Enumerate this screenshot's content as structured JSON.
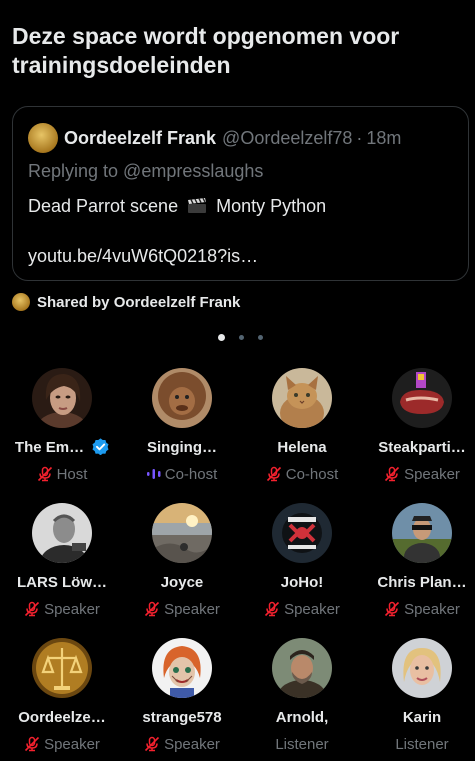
{
  "space": {
    "title": "Deze space wordt opgenomen voor trainingsdoeleinden"
  },
  "pinned_tweet": {
    "author_name": "Oordeelzelf Frank",
    "author_handle": "@Oordeelzelf78",
    "separator": "·",
    "time": "18m",
    "replying_to": "Replying to @empresslaughs",
    "text_before": "Dead Parrot scene",
    "text_after": "Monty Python",
    "emoji_icon": "clapper-board-icon",
    "link": "youtu.be/4vuW6tQ0218?is…"
  },
  "shared": {
    "label": "Shared by Oordeelzelf Frank"
  },
  "pager": {
    "total": 3,
    "active": 1
  },
  "participants": [
    {
      "name": "The Em…",
      "role": "Host",
      "verified": true,
      "mic": "muted"
    },
    {
      "name": "Singing…",
      "role": "Co-host",
      "verified": false,
      "mic": "speaking"
    },
    {
      "name": "Helena",
      "role": "Co-host",
      "verified": false,
      "mic": "muted"
    },
    {
      "name": "Steakparti…",
      "role": "Speaker",
      "verified": false,
      "mic": "muted"
    },
    {
      "name": "LARS Löw…",
      "role": "Speaker",
      "verified": false,
      "mic": "muted"
    },
    {
      "name": "Joyce",
      "role": "Speaker",
      "verified": false,
      "mic": "muted"
    },
    {
      "name": "JoHo!",
      "role": "Speaker",
      "verified": false,
      "mic": "muted"
    },
    {
      "name": "Chris Plan…",
      "role": "Speaker",
      "verified": false,
      "mic": "muted"
    },
    {
      "name": "Oordeelze…",
      "role": "Speaker",
      "verified": false,
      "mic": "muted"
    },
    {
      "name": "strange578",
      "role": "Speaker",
      "verified": false,
      "mic": "muted"
    },
    {
      "name": "Arnold,",
      "role": "Listener",
      "verified": false,
      "mic": "none"
    },
    {
      "name": "Karin",
      "role": "Listener",
      "verified": false,
      "mic": "none"
    }
  ],
  "colors": {
    "background": "#000000",
    "text": "#e7e9ea",
    "muted_text": "#71767b",
    "muted_mic": "#f4212e",
    "cohost_accent": "#7856ff",
    "verified": "#1d9bf0"
  }
}
